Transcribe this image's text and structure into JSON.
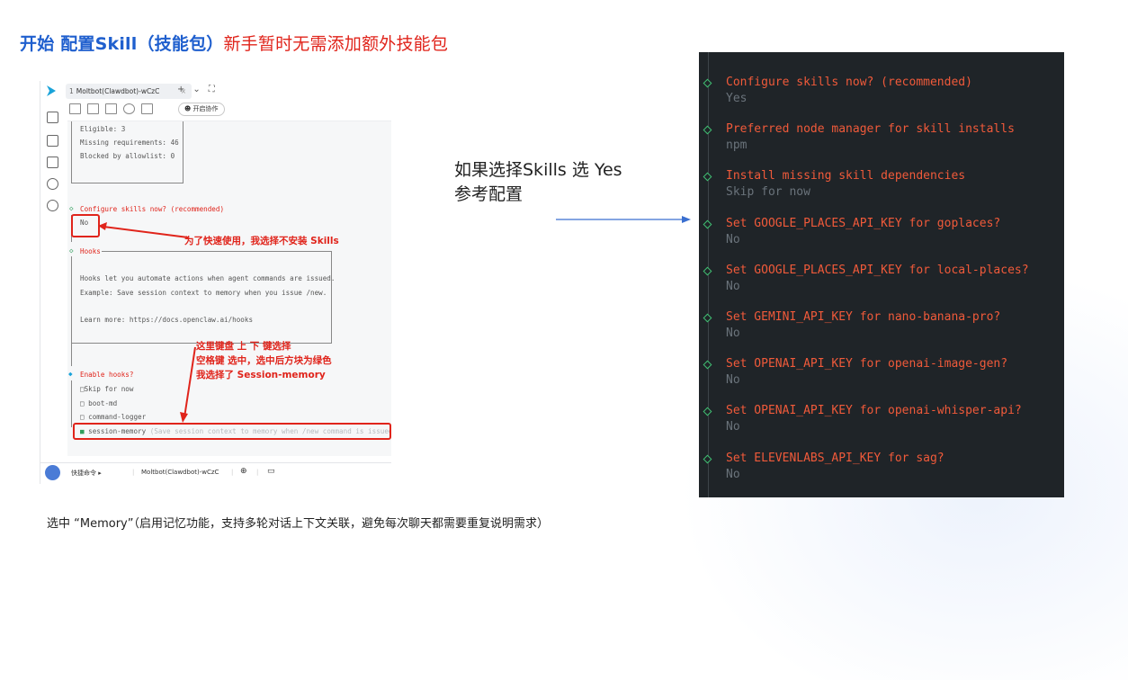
{
  "slide": {
    "title_part1": "开始 配置Skill（技能包）",
    "title_part2": "新手暂时无需添加额外技能包",
    "middle_line1": "如果选择Skills 选 Yes",
    "middle_line2": "参考配置",
    "footer_note": "选中 “Memory”（启用记忆功能，支持多轮对话上下文关联，避免每次聊天都需要重复说明需求）"
  },
  "window": {
    "tab_number": "1",
    "tab_title": "Moltbot(Clawdbot)-wCzC",
    "tab_close": "×",
    "tab_add": "+",
    "tab_dropdown": "⌄",
    "tab_expand": "⛶",
    "collab_button": "开启协作",
    "bottom_quick_cmd": "快捷命令 ▸",
    "bottom_session": "Moltbot(Clawdbot)-wCzC"
  },
  "terminal": {
    "eligible": "Eligible: 3",
    "missing": "Missing requirements: 46",
    "blocked": "Blocked by allowlist: 0",
    "configure_q": "Configure skills now? (recommended)",
    "configure_a": "No",
    "hooks_label": "Hooks",
    "hooks_desc1": "Hooks let you automate actions when agent commands are issued.",
    "hooks_desc2": "Example: Save session context to memory when you issue /new.",
    "hooks_learn": "Learn more: https://docs.openclaw.ai/hooks",
    "enable_hooks_q": "Enable hooks?",
    "options": [
      {
        "label": "Skip for now",
        "box": "□"
      },
      {
        "label": "boot-md",
        "box": "□"
      },
      {
        "label": "command-logger",
        "box": "□"
      },
      {
        "label": "session-memory",
        "box": "■",
        "hint": "(Save session context to memory when /new command is issued)"
      }
    ]
  },
  "annotations": {
    "no_skills": "为了快速使用，我选择不安装 Skills",
    "keys_line1": "这里键盘 上 下 键选择",
    "keys_line2": "空格键 选中，选中后方块为绿色",
    "keys_line3": "我选择了 Session-memory"
  },
  "dark_terminal": {
    "items": [
      {
        "q": "Configure skills now? (recommended)",
        "a": "Yes"
      },
      {
        "q": "Preferred node manager for skill installs",
        "a": "npm"
      },
      {
        "q": "Install missing skill dependencies",
        "a": "Skip for now"
      },
      {
        "q": "Set GOOGLE_PLACES_API_KEY for goplaces?",
        "a": "No"
      },
      {
        "q": "Set GOOGLE_PLACES_API_KEY for local-places?",
        "a": "No"
      },
      {
        "q": "Set GEMINI_API_KEY for nano-banana-pro?",
        "a": "No"
      },
      {
        "q": "Set OPENAI_API_KEY for openai-image-gen?",
        "a": "No"
      },
      {
        "q": "Set OPENAI_API_KEY for openai-whisper-api?",
        "a": "No"
      },
      {
        "q": "Set ELEVENLABS_API_KEY for sag?",
        "a": "No"
      }
    ]
  },
  "colors": {
    "title_blue": "#1f5fce",
    "annotation_red": "#e0241b",
    "terminal_bg": "#1f2428",
    "question_orange": "#f05a3a",
    "answer_gray": "#6a737b",
    "diamond_green": "#40c072"
  },
  "icons": {
    "app_logo": "app-logo-icon",
    "diamond": "diamond-bullet-icon",
    "arrow": "arrow-right-icon"
  }
}
